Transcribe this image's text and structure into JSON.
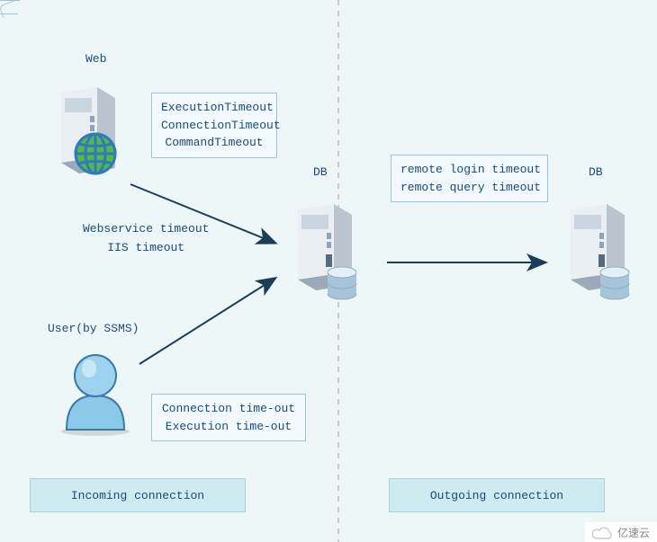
{
  "labels": {
    "web": "Web",
    "db1": "DB",
    "db2": "DB",
    "user": "User(by SSMS)"
  },
  "callouts": {
    "web": {
      "lines": [
        "ExecutionTimeout",
        "ConnectionTimeout",
        "CommandTimeout"
      ]
    },
    "remote": {
      "lines": [
        "remote login timeout",
        "remote query timeout"
      ]
    },
    "user": {
      "lines": [
        "Connection time-out",
        "Execution time-out"
      ]
    }
  },
  "midtext": {
    "lines": [
      "Webservice timeout",
      "IIS timeout"
    ]
  },
  "panes": {
    "incoming": "Incoming connection",
    "outgoing": "Outgoing connection"
  },
  "watermark": "亿速云"
}
